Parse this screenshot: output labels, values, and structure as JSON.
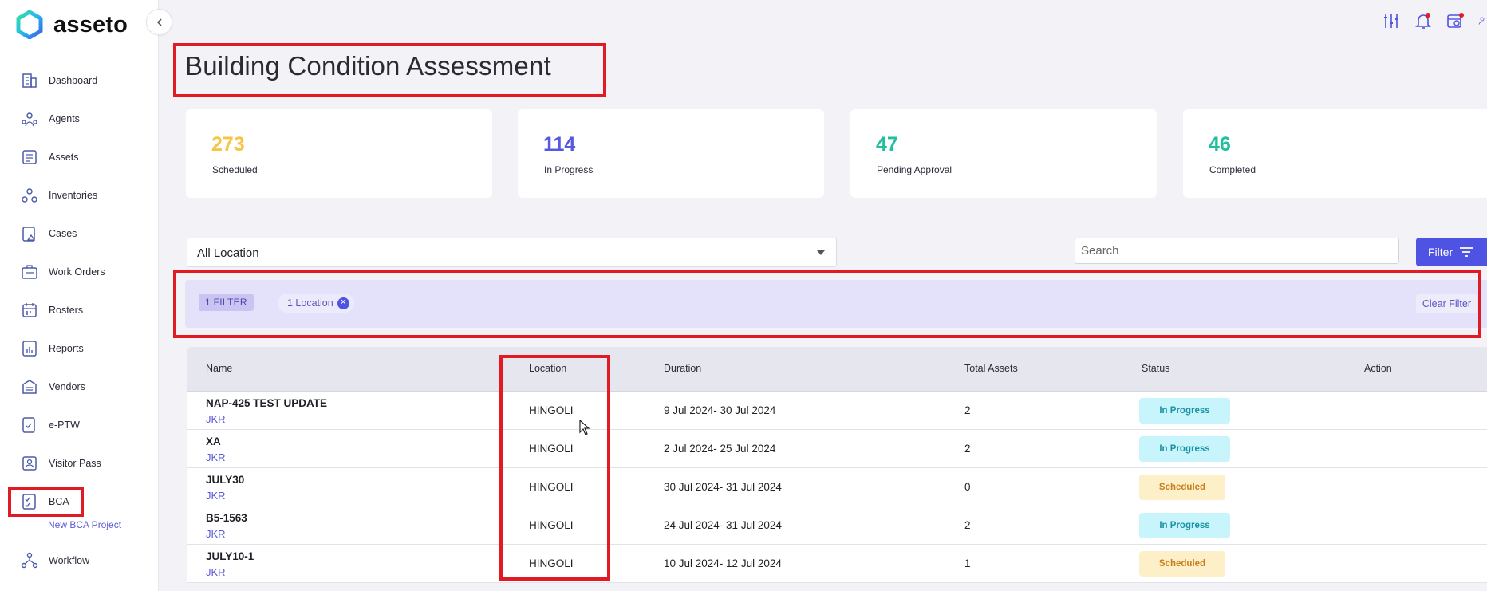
{
  "app": {
    "name": "asseto"
  },
  "sidebar": {
    "items": [
      {
        "label": "Dashboard",
        "icon": "building-icon"
      },
      {
        "label": "Agents",
        "icon": "agents-icon"
      },
      {
        "label": "Assets",
        "icon": "assets-icon"
      },
      {
        "label": "Inventories",
        "icon": "inventories-icon"
      },
      {
        "label": "Cases",
        "icon": "cases-icon"
      },
      {
        "label": "Work Orders",
        "icon": "work-orders-icon"
      },
      {
        "label": "Rosters",
        "icon": "calendar-icon"
      },
      {
        "label": "Reports",
        "icon": "reports-icon"
      },
      {
        "label": "Vendors",
        "icon": "vendors-icon"
      },
      {
        "label": "e-PTW",
        "icon": "permit-icon"
      },
      {
        "label": "Visitor Pass",
        "icon": "visitor-icon"
      },
      {
        "label": "BCA",
        "icon": "checklist-icon"
      },
      {
        "label": "Workflow",
        "icon": "workflow-icon"
      }
    ],
    "sub_item": "New BCA Project"
  },
  "header": {
    "icons": [
      "sliders-icon",
      "bell-icon",
      "calendar-refresh-icon",
      "user-icon"
    ]
  },
  "page": {
    "title": "Building Condition Assessment"
  },
  "stats": [
    {
      "value": "273",
      "label": "Scheduled",
      "color": "#f7c544"
    },
    {
      "value": "114",
      "label": "In Progress",
      "color": "#5558e0"
    },
    {
      "value": "47",
      "label": "Pending Approval",
      "color": "#1fbf9f"
    },
    {
      "value": "46",
      "label": "Completed",
      "color": "#1fbf9f"
    }
  ],
  "controls": {
    "location_select": "All Location",
    "search_placeholder": "Search",
    "filter_label": "Filter"
  },
  "filter_bar": {
    "count_label": "1 FILTER",
    "location_chip": "1 Location",
    "clear_label": "Clear Filter"
  },
  "table": {
    "columns": [
      "Name",
      "Location",
      "Duration",
      "Total Assets",
      "Status",
      "Action"
    ],
    "rows": [
      {
        "name": "NAP-425 TEST UPDATE",
        "sub": "JKR",
        "location": "HINGOLI",
        "duration": "9 Jul 2024- 30 Jul 2024",
        "total": "2",
        "status": "In Progress"
      },
      {
        "name": "XA",
        "sub": "JKR",
        "location": "HINGOLI",
        "duration": "2 Jul 2024- 25 Jul 2024",
        "total": "2",
        "status": "In Progress"
      },
      {
        "name": "JULY30",
        "sub": "JKR",
        "location": "HINGOLI",
        "duration": "30 Jul 2024- 31 Jul 2024",
        "total": "0",
        "status": "Scheduled"
      },
      {
        "name": "B5-1563",
        "sub": "JKR",
        "location": "HINGOLI",
        "duration": "24 Jul 2024- 31 Jul 2024",
        "total": "2",
        "status": "In Progress"
      },
      {
        "name": "JULY10-1",
        "sub": "JKR",
        "location": "HINGOLI",
        "duration": "10 Jul 2024- 12 Jul 2024",
        "total": "1",
        "status": "Scheduled"
      }
    ]
  }
}
